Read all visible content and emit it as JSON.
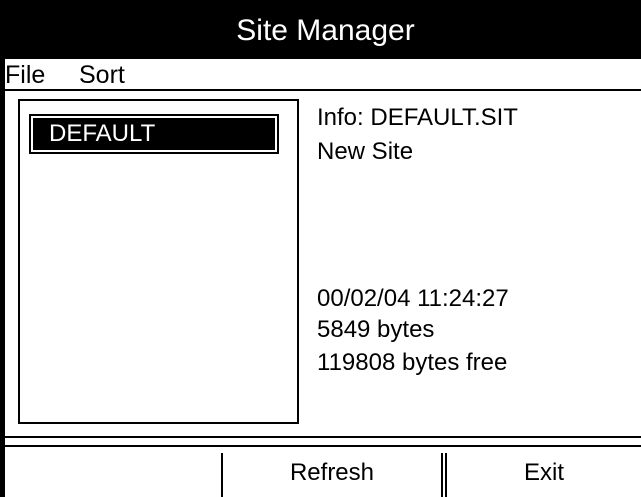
{
  "window": {
    "title": "Site Manager"
  },
  "menu": {
    "items": [
      "File",
      "Sort"
    ]
  },
  "site_list": {
    "items": [
      {
        "label": "DEFAULT",
        "selected": true
      }
    ]
  },
  "info": {
    "header": "Info: DEFAULT.SIT",
    "name": "New Site",
    "timestamp": "00/02/04 11:24:27",
    "size": "5849 bytes",
    "free": "119808 bytes free"
  },
  "softkeys": [
    "",
    "Refresh",
    "Exit"
  ]
}
